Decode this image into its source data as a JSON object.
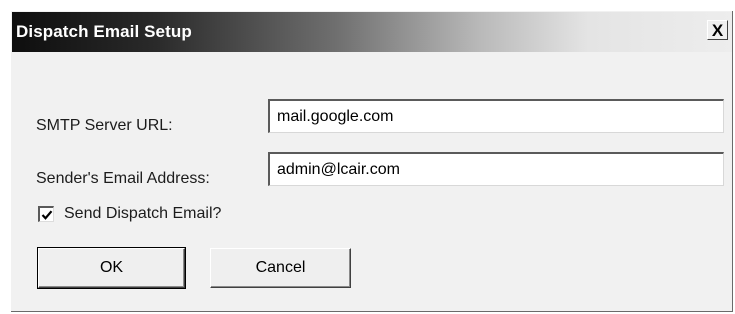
{
  "dialog": {
    "title": "Dispatch Email Setup",
    "close_label": "X"
  },
  "form": {
    "smtp_label": "SMTP Server URL:",
    "smtp_value": "mail.google.com",
    "sender_label": "Sender's Email Address:",
    "sender_value": "admin@lcair.com",
    "send_checkbox_label": "Send Dispatch Email?",
    "send_checked": true
  },
  "buttons": {
    "ok_label": "OK",
    "cancel_label": "Cancel"
  },
  "icons": {
    "close": "close-icon",
    "check": "checkmark-icon"
  }
}
